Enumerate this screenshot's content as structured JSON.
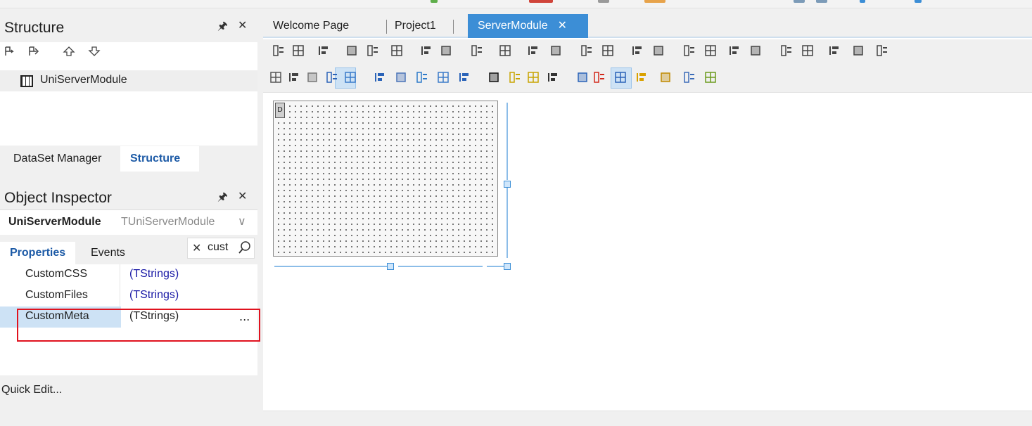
{
  "structure": {
    "title": "Structure",
    "tree_item": "UniServerModule",
    "bottom_tabs": [
      "DataSet Manager",
      "Structure"
    ]
  },
  "object_inspector": {
    "title": "Object Inspector",
    "selected_name": "UniServerModule",
    "selected_type": "TUniServerModule",
    "tabs": [
      "Properties",
      "Events"
    ],
    "search_value": "cust",
    "properties": [
      {
        "name": "CustomCSS",
        "value": "(TStrings)"
      },
      {
        "name": "CustomFiles",
        "value": "(TStrings)"
      },
      {
        "name": "CustomMeta",
        "value": "(TStrings)",
        "ellipsis": "..."
      }
    ]
  },
  "quick_edit": "Quick Edit...",
  "editor": {
    "tabs": [
      "Welcome Page",
      "Project1",
      "ServerModule"
    ],
    "active_tab": "ServerModule"
  },
  "colors": {
    "accent": "#3c8ed6",
    "highlight": "#e0121e",
    "selection": "#cde2f5"
  }
}
